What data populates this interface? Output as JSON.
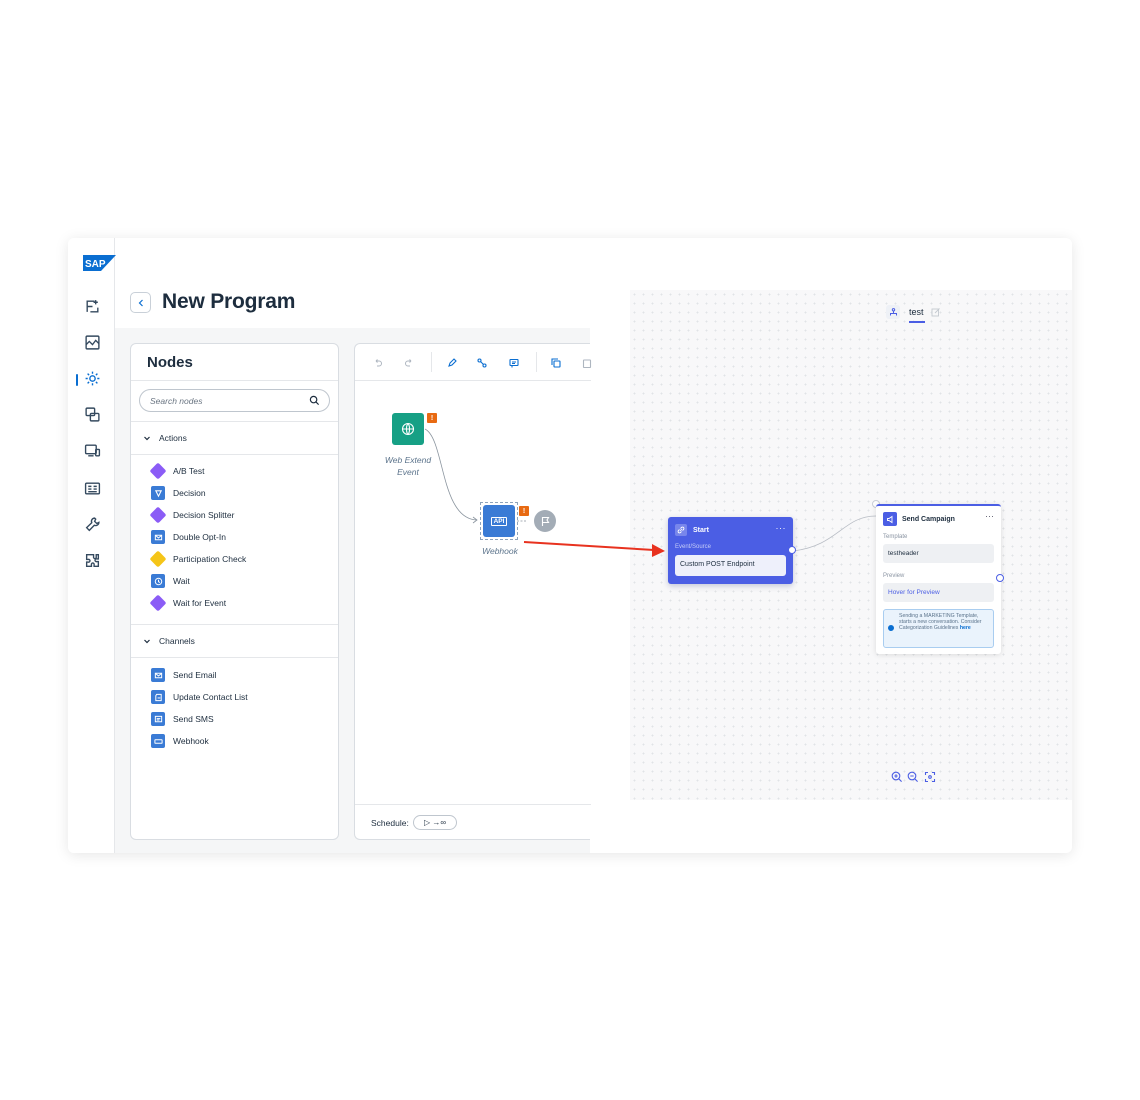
{
  "brand": {
    "logo_text": "SAP"
  },
  "header": {
    "title": "New Program",
    "back_icon": "chevron-left-icon"
  },
  "sidebar": {
    "items": [
      {
        "name": "journeys-icon"
      },
      {
        "name": "analytics-icon"
      },
      {
        "name": "programs-icon",
        "active": true
      },
      {
        "name": "campaigns-icon"
      },
      {
        "name": "devices-icon"
      },
      {
        "name": "contacts-icon"
      },
      {
        "name": "tools-icon"
      },
      {
        "name": "extensions-icon"
      }
    ]
  },
  "nodes_panel": {
    "title": "Nodes",
    "search_placeholder": "Search nodes",
    "actions": {
      "label": "Actions",
      "items": [
        {
          "label": "A/B Test",
          "shape": "diamond",
          "color": "#8b5cf6"
        },
        {
          "label": "Decision",
          "shape": "square",
          "color": "#3a7bd5"
        },
        {
          "label": "Decision Splitter",
          "shape": "diamond",
          "color": "#8b5cf6"
        },
        {
          "label": "Double Opt-In",
          "shape": "square",
          "color": "#3a7bd5"
        },
        {
          "label": "Participation Check",
          "shape": "diamond",
          "color": "#f5c518"
        },
        {
          "label": "Wait",
          "shape": "square",
          "color": "#3a7bd5"
        },
        {
          "label": "Wait for Event",
          "shape": "diamond",
          "color": "#8b5cf6"
        }
      ]
    },
    "channels": {
      "label": "Channels",
      "items": [
        {
          "label": "Send Email",
          "color": "#3a7bd5"
        },
        {
          "label": "Update Contact List",
          "color": "#3a7bd5"
        },
        {
          "label": "Send SMS",
          "color": "#3a7bd5"
        },
        {
          "label": "Webhook",
          "color": "#3a7bd5"
        }
      ]
    }
  },
  "canvas": {
    "nodes": {
      "web_extend_event": {
        "label_line1": "Web Extend",
        "label_line2": "Event",
        "warning": "!",
        "color": "#16a085"
      },
      "webhook": {
        "label": "Webhook",
        "badge": "API",
        "warning": "!",
        "color": "#3a7bd5"
      }
    },
    "schedule": {
      "label": "Schedule:",
      "value": "▷ →∞"
    }
  },
  "editor": {
    "tab": {
      "label": "test"
    },
    "start_node": {
      "title": "Start",
      "more": "···",
      "sub_label": "Event/Source",
      "field_value": "Custom POST Endpoint"
    },
    "send_node": {
      "title": "Send Campaign",
      "more": "···",
      "template_label": "Template",
      "template_value": "testheader",
      "preview_label": "Preview",
      "preview_value": "Hover for Preview",
      "info_text": "Sending a MARKETING Template, starts a new conversation. Consider Categorization Guidelines",
      "info_link": "here"
    }
  },
  "colors": {
    "accent": "#4b5ee4",
    "annotation_arrow": "#e8321f",
    "warning": "#e86a12"
  }
}
